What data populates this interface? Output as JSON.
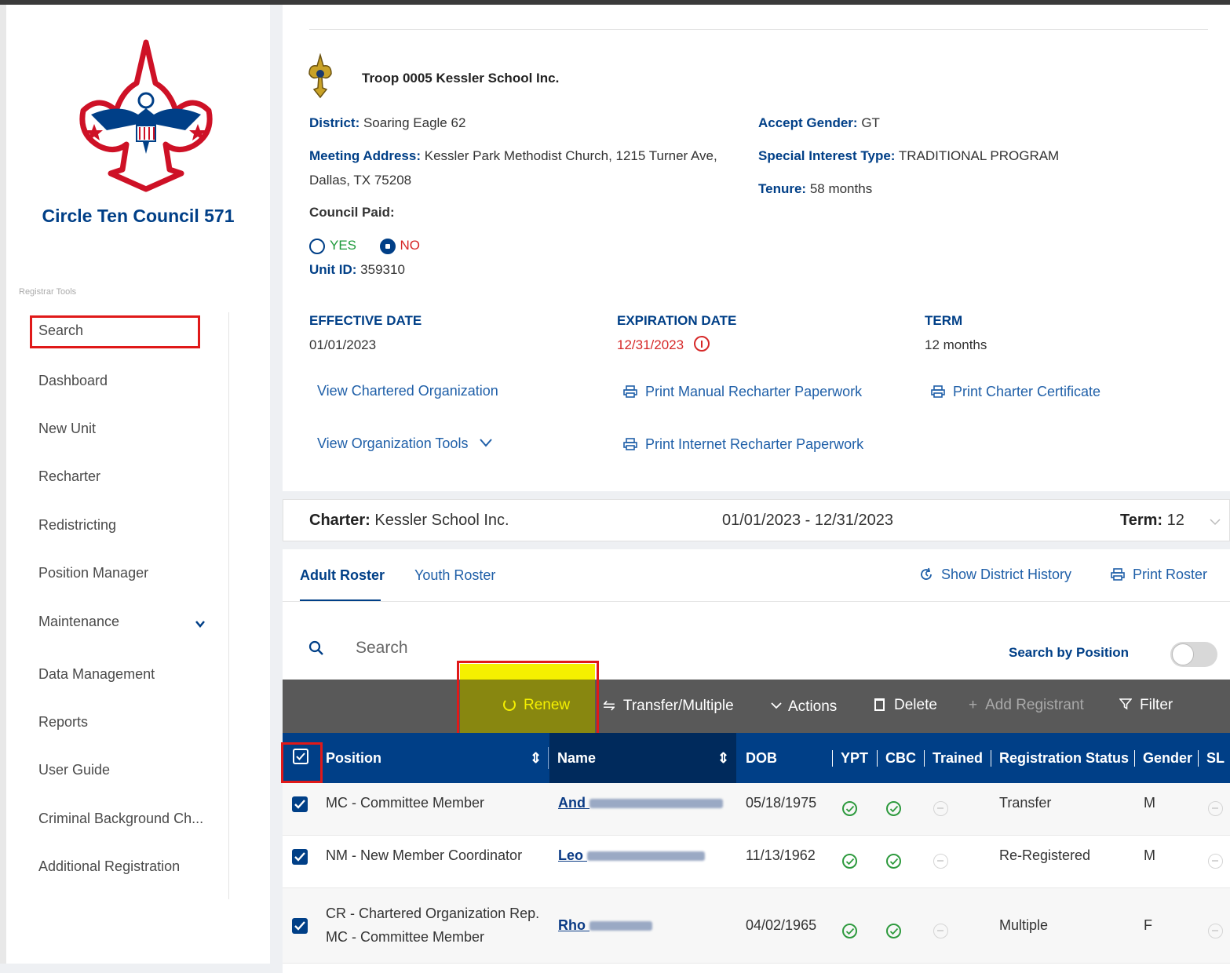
{
  "sidebar": {
    "council_name": "Circle Ten Council 571",
    "section_label": "Registrar Tools",
    "items": [
      {
        "label": "Search"
      },
      {
        "label": "Dashboard"
      },
      {
        "label": "New Unit"
      },
      {
        "label": "Recharter"
      },
      {
        "label": "Redistricting"
      },
      {
        "label": "Position Manager"
      },
      {
        "label": "Maintenance"
      },
      {
        "label": "Data Management"
      },
      {
        "label": "Reports"
      },
      {
        "label": "User Guide"
      },
      {
        "label": "Criminal Background Ch..."
      },
      {
        "label": "Additional Registration"
      }
    ]
  },
  "unit": {
    "title": "Troop 0005 Kessler School Inc.",
    "district_label": "District:",
    "district": "Soaring Eagle 62",
    "address_label": "Meeting Address:",
    "address_line1": "Kessler Park Methodist Church, 1215 Turner Ave,",
    "address_line2": "Dallas, TX 75208",
    "council_paid_label": "Council Paid:",
    "yes": "YES",
    "no": "NO",
    "council_paid_value": "NO",
    "unit_id_label": "Unit ID:",
    "unit_id": "359310",
    "gender_label": "Accept Gender:",
    "gender": "GT",
    "interest_label": "Special Interest Type:",
    "interest": "TRADITIONAL PROGRAM",
    "tenure_label": "Tenure:",
    "tenure": "58 months",
    "effective_label": "EFFECTIVE DATE",
    "effective": "01/01/2023",
    "expiration_label": "EXPIRATION DATE",
    "expiration": "12/31/2023",
    "term_label": "TERM",
    "term": "12 months",
    "view_org": "View Chartered Organization",
    "view_tools": "View Organization Tools",
    "print_manual": "Print Manual Recharter Paperwork",
    "print_internet": "Print Internet Recharter Paperwork",
    "print_cert": "Print Charter Certificate"
  },
  "charter": {
    "label": "Charter:",
    "name": "Kessler School Inc.",
    "dates": "01/01/2023 - 12/31/2023",
    "term_label": "Term:",
    "term": "12"
  },
  "roster": {
    "tabs": [
      "Adult Roster",
      "Youth Roster"
    ],
    "history": "Show District History",
    "print": "Print Roster",
    "search_placeholder": "Search",
    "search_by_position": "Search by Position",
    "toolbar": {
      "renew": "Renew",
      "transfer": "Transfer/Multiple",
      "actions": "Actions",
      "delete": "Delete",
      "add": "Add Registrant",
      "filter": "Filter"
    },
    "columns": [
      "Position",
      "Name",
      "DOB",
      "YPT",
      "CBC",
      "Trained",
      "Registration Status",
      "Gender",
      "SL"
    ],
    "rows": [
      {
        "position": "MC - Committee Member",
        "position2": "",
        "name_visible": "And",
        "dob": "05/18/1975",
        "status": "Transfer",
        "gender": "M"
      },
      {
        "position": "NM - New Member Coordinator",
        "position2": "",
        "name_visible": "Leo",
        "dob": "11/13/1962",
        "status": "Re-Registered",
        "gender": "M"
      },
      {
        "position": "CR - Chartered Organization Rep.",
        "position2": "MC - Committee Member",
        "name_visible": "Rho",
        "dob": "04/02/1965",
        "status": "Multiple",
        "gender": "F"
      }
    ]
  },
  "colors": {
    "brand": "#003f87",
    "highlight": "#e01919",
    "yellow": "#f5f000"
  }
}
